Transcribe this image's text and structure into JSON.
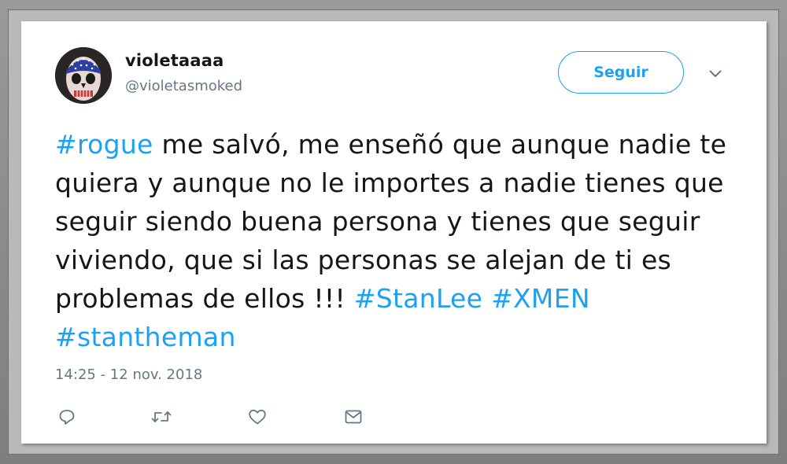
{
  "tweet": {
    "display_name": "violetaaaa",
    "handle": "@violetasmoked",
    "follow_label": "Seguir",
    "text_segments": [
      {
        "text": "#rogue",
        "type": "hashtag"
      },
      {
        "text": " me salvó, me enseñó que aunque nadie te quiera y aunque no le importes a nadie tienes que seguir siendo buena persona y tienes que seguir viviendo, que si las personas se alejan de ti es problemas de ellos !!! ",
        "type": "text"
      },
      {
        "text": "#StanLee",
        "type": "hashtag"
      },
      {
        "text": " ",
        "type": "text"
      },
      {
        "text": "#XMEN",
        "type": "hashtag"
      },
      {
        "text": " ",
        "type": "text"
      },
      {
        "text": "#stantheman",
        "type": "hashtag"
      }
    ],
    "timestamp": "14:25 - 12 nov. 2018"
  },
  "icons": {
    "more": "chevron-down-icon",
    "reply": "reply-icon",
    "retweet": "retweet-icon",
    "like": "heart-icon",
    "message": "envelope-icon"
  },
  "colors": {
    "accent": "#1da1f2",
    "text": "#14171a",
    "muted": "#657786"
  }
}
